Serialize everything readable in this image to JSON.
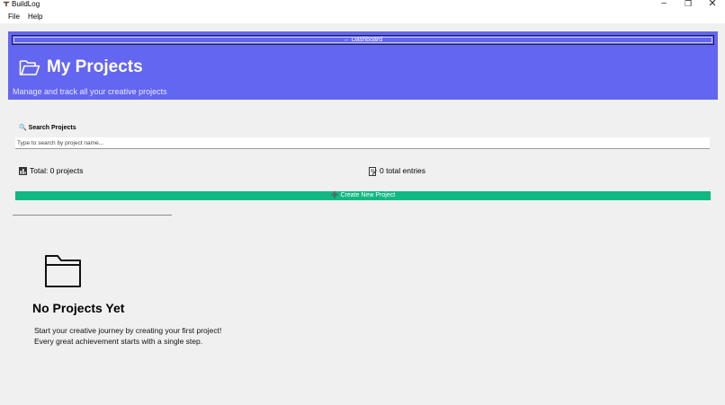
{
  "window": {
    "title": "BuildLog",
    "minimize_glyph": "–",
    "maximize_glyph": "❐",
    "close_glyph": "✕"
  },
  "menu": {
    "items": [
      "File",
      "Help"
    ]
  },
  "header": {
    "back_label": "← Dashboard",
    "title": "My Projects",
    "subtitle": "Manage and track all your creative projects",
    "background": "#6366f1"
  },
  "search": {
    "label": "Search Projects",
    "icon": "🔍",
    "placeholder": "Type to search by project name...",
    "value": ""
  },
  "stats": {
    "total_label": "Total: 0 projects",
    "entries_label": "0 total entries"
  },
  "create_button": {
    "label": "➕ Create New Project",
    "color": "#10b981"
  },
  "empty_state": {
    "title": "No Projects Yet",
    "line1": "Start your creative journey by creating your first project!",
    "line2": "Every great achievement starts with a single step."
  }
}
